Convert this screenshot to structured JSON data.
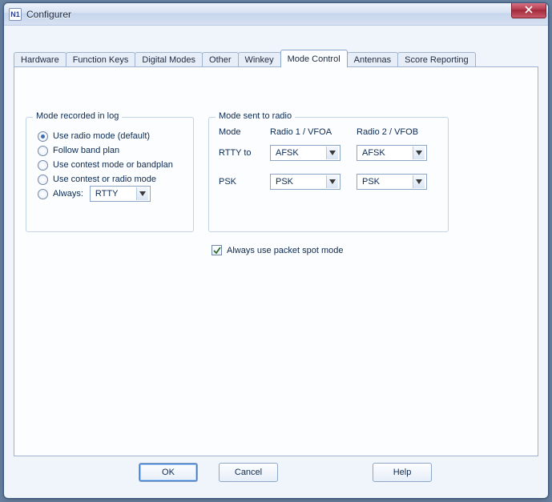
{
  "window": {
    "title": "Configurer"
  },
  "tabs": [
    {
      "label": "Hardware"
    },
    {
      "label": "Function Keys"
    },
    {
      "label": "Digital Modes"
    },
    {
      "label": "Other"
    },
    {
      "label": "Winkey"
    },
    {
      "label": "Mode Control",
      "active": true
    },
    {
      "label": "Antennas"
    },
    {
      "label": "Score Reporting"
    }
  ],
  "group_left": {
    "legend": "Mode recorded in log",
    "options": {
      "use_radio": "Use radio mode (default)",
      "follow_band": "Follow band plan",
      "contest_or_bandplan": "Use contest mode or bandplan",
      "contest_or_radio": "Use contest or radio mode",
      "always": "Always:"
    },
    "selected": "use_radio",
    "always_combo": {
      "value": "RTTY"
    }
  },
  "group_right": {
    "legend": "Mode sent to radio",
    "headers": {
      "mode": "Mode",
      "r1": "Radio 1 / VFOA",
      "r2": "Radio 2 / VFOB"
    },
    "rows": {
      "rtty": {
        "label": "RTTY  to",
        "r1": "AFSK",
        "r2": "AFSK"
      },
      "psk": {
        "label": "PSK",
        "r1": "PSK",
        "r2": "PSK"
      }
    }
  },
  "packet_spot": {
    "label": "Always use packet spot mode",
    "checked": true
  },
  "buttons": {
    "ok": "OK",
    "cancel": "Cancel",
    "help": "Help"
  }
}
